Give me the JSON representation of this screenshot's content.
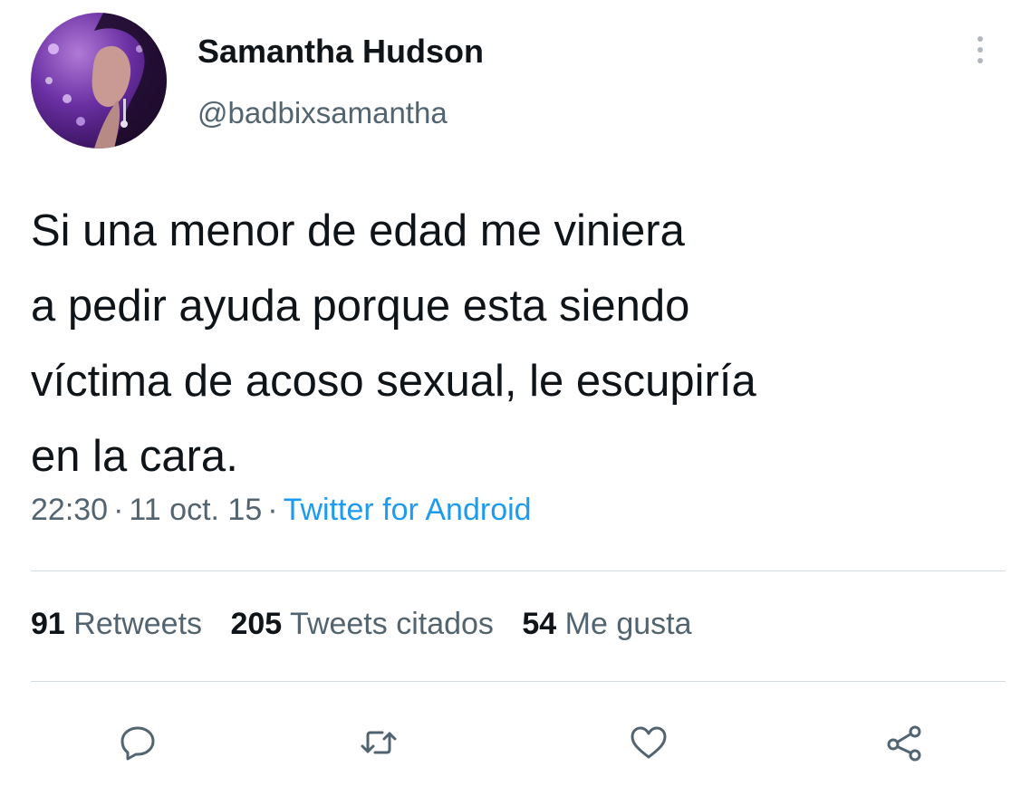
{
  "author": {
    "display_name": "Samantha Hudson",
    "handle": "@badbixsamantha"
  },
  "tweet": {
    "text": "Si una menor de edad me viniera\na pedir ayuda porque esta siendo\nvíctima de acoso sexual, le escupiría\nen la cara.",
    "time": "22:30",
    "date": "11 oct. 15",
    "source": "Twitter for Android"
  },
  "stats": {
    "retweets_count": "91",
    "retweets_label": "Retweets",
    "quotes_count": "205",
    "quotes_label": "Tweets citados",
    "likes_count": "54",
    "likes_label": "Me gusta"
  },
  "actions": [
    {
      "icon": "reply-icon"
    },
    {
      "icon": "retweet-icon"
    },
    {
      "icon": "like-icon"
    },
    {
      "icon": "share-icon"
    }
  ],
  "colors": {
    "text": "#0f1419",
    "secondary": "#536471",
    "link": "#1d9bf0",
    "divider": "#d6dde2"
  }
}
